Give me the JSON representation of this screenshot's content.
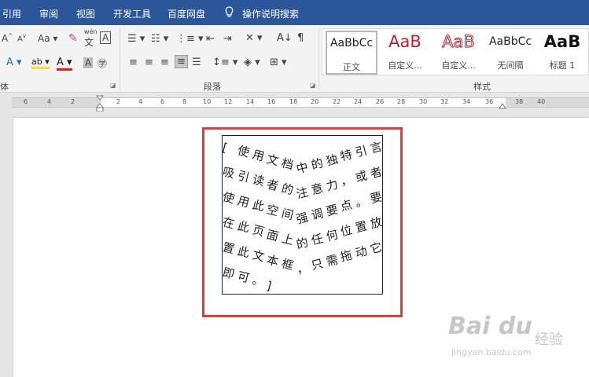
{
  "menubar": {
    "tabs": [
      "引用",
      "审阅",
      "视图",
      "开发工具",
      "百度网盘"
    ],
    "tell_me": "操作说明搜索"
  },
  "ribbon": {
    "font_group_label": "体",
    "paragraph_group_label": "段落",
    "styles_group_label": "样式",
    "font_size_label": "Aa",
    "wen_label": "wén",
    "wen_char": "文",
    "styles": [
      {
        "sample": "AaBbCc",
        "name": "正文",
        "color": "#222222"
      },
      {
        "sample": "AaB",
        "name": "自定义...",
        "color": "#c0202b"
      },
      {
        "sample": "AaB",
        "name": "自定义...",
        "color": "#c0202b"
      },
      {
        "sample": "AaBbCc",
        "name": "无间隔",
        "color": "#222222"
      },
      {
        "sample": "AaB",
        "name": "标题 1",
        "color": "#111111"
      }
    ]
  },
  "ruler": {
    "numbers": [
      "6",
      "4",
      "2",
      "2",
      "4",
      "6",
      "8",
      "10",
      "12",
      "14",
      "16",
      "18",
      "20",
      "22",
      "24",
      "26",
      "28",
      "30",
      "32",
      "34",
      "36",
      "38",
      "40"
    ]
  },
  "textbox": {
    "text": "[使用文档中的独特引言吸引读者的注意力，或者使用此空间强调要点。要在此页面上的任何位置放置此文本框，只需拖动它即可。]"
  },
  "watermark": {
    "logo": "Bai du",
    "text": "经验",
    "url": "jingyan.baidu.com"
  },
  "colors": {
    "menubar": "#2b579a",
    "highlight": "#e03c3c",
    "accent_red": "#c0202b"
  }
}
